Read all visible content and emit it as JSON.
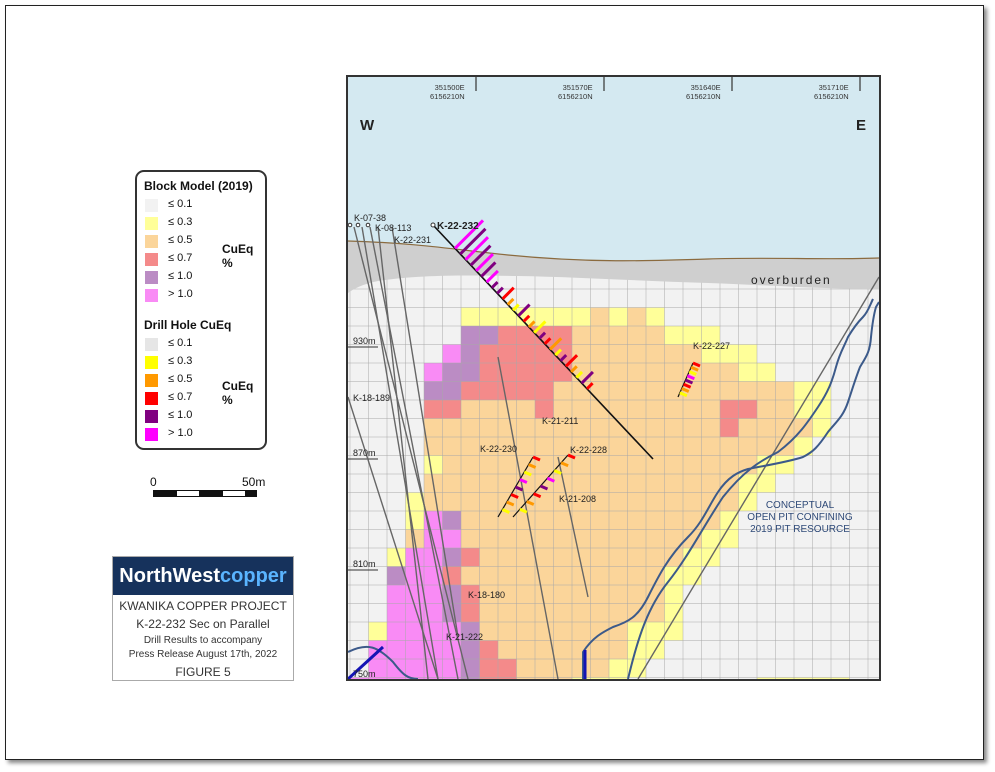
{
  "legend": {
    "block_title": "Block Model (2019)",
    "block_unit": "CuEq %",
    "block_items": [
      {
        "label": "≤ 0.1",
        "color": "#f2f2f2"
      },
      {
        "label": "≤ 0.3",
        "color": "#ffff99"
      },
      {
        "label": "≤ 0.5",
        "color": "#fbd59a"
      },
      {
        "label": "≤ 0.7",
        "color": "#f48a8a"
      },
      {
        "label": "≤ 1.0",
        "color": "#bb8cc4"
      },
      {
        "label": "> 1.0",
        "color": "#f98bf5"
      }
    ],
    "drill_title": "Drill Hole CuEq",
    "drill_unit": "CuEq %",
    "drill_items": [
      {
        "label": "≤ 0.1",
        "color": "#e6e6e6"
      },
      {
        "label": "≤ 0.3",
        "color": "#ffff00"
      },
      {
        "label": "≤ 0.5",
        "color": "#ff9900"
      },
      {
        "label": "≤ 0.7",
        "color": "#ff0000"
      },
      {
        "label": "≤ 1.0",
        "color": "#800080"
      },
      {
        "label": "> 1.0",
        "color": "#ff00ff"
      }
    ]
  },
  "scale": {
    "start": "0",
    "end": "50m"
  },
  "logo": {
    "brand_a": "NorthWest",
    "brand_b": "copper",
    "project": "KWANIKA COPPER PROJECT",
    "section": "K-22-232 Sec on Parallel",
    "line3": "Drill Results to accompany",
    "line4": "Press Release August 17th, 2022",
    "figure": "FIGURE 5"
  },
  "map": {
    "west": "W",
    "east": "E",
    "overburden": "overburden",
    "pit_label": [
      "CONCEPTUAL",
      "OPEN PIT CONFINING",
      "2019 PIT RESOURCE"
    ],
    "coords": [
      {
        "e": "351500E",
        "n": "6156210N"
      },
      {
        "e": "351570E",
        "n": "6156210N"
      },
      {
        "e": "351640E",
        "n": "6156210N"
      },
      {
        "e": "351710E",
        "n": "6156210N"
      }
    ],
    "elevations": [
      "930m",
      "870m",
      "810m",
      "750m"
    ],
    "holes": {
      "k0738": "K-07-38",
      "k08113": "K-08-113",
      "k22231": "K-22-231",
      "k22232": "K-22-232",
      "k22227": "K-22-227",
      "k18189": "K-18-189",
      "k21211": "K-21-211",
      "k22230": "K-22-230",
      "k22228": "K-22-228",
      "k21208": "K-21-208",
      "k18180": "K-18-180",
      "k21222": "K-21-222"
    },
    "colors": {
      "sky": "#d4e9f1",
      "overburden": "#cfcfcf",
      "pit": "#3c5a8a",
      "grid": "#a8a8a8"
    }
  }
}
